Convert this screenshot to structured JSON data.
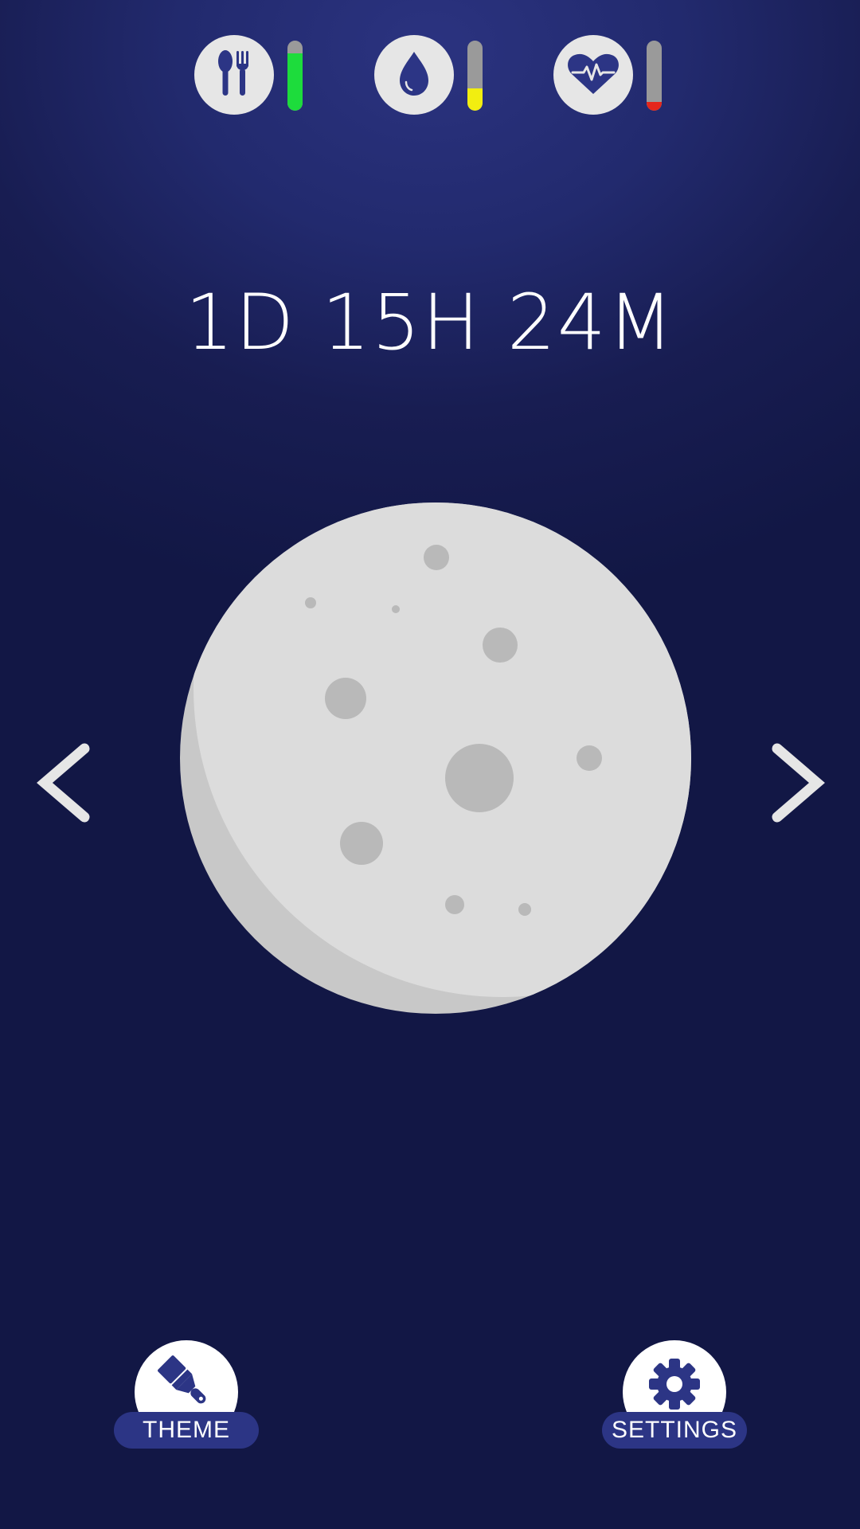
{
  "stats": {
    "food": {
      "icon": "utensils-icon",
      "level": 0.82,
      "fill_color": "#1ddc3c"
    },
    "water": {
      "icon": "water-drop-icon",
      "level": 0.32,
      "fill_color": "#f2ee10"
    },
    "health": {
      "icon": "heartbeat-icon",
      "level": 0.12,
      "fill_color": "#e5261b"
    }
  },
  "timer": {
    "text": "1D 15H 24M"
  },
  "navigation": {
    "prev_icon": "chevron-left-icon",
    "next_icon": "chevron-right-icon"
  },
  "pet": {
    "icon": "moon-icon"
  },
  "buttons": {
    "theme": {
      "label": "THEME",
      "icon": "paintbrush-icon"
    },
    "settings": {
      "label": "SETTINGS",
      "icon": "gear-icon"
    }
  },
  "colors": {
    "background": "#1b2058",
    "icon_accent": "#2c3585",
    "moon": "#dcdcdc",
    "crater": "#b9b9b9"
  }
}
